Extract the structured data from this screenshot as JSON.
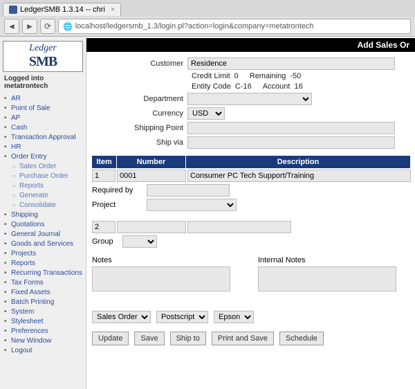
{
  "browser": {
    "tab_title": "LedgerSMB 1.3.14 -- chri",
    "url": "localhost/ledgersmb_1.3/login.pl?action=login&company=metatrontech"
  },
  "sidebar": {
    "logo_top": "Ledger",
    "logo_bottom": "SMB",
    "logged_in": "Logged into metatrontech",
    "items": [
      {
        "label": "AR",
        "sub": []
      },
      {
        "label": "Point of Sale",
        "sub": []
      },
      {
        "label": "AP",
        "sub": []
      },
      {
        "label": "Cash",
        "sub": []
      },
      {
        "label": "Transaction Approval",
        "sub": []
      },
      {
        "label": "HR",
        "sub": []
      },
      {
        "label": "Order Entry",
        "sub": [
          {
            "label": "Sales Order"
          },
          {
            "label": "Purchase Order"
          },
          {
            "label": "Reports"
          },
          {
            "label": "Generate"
          },
          {
            "label": "Consolidate"
          }
        ]
      },
      {
        "label": "Shipping",
        "sub": []
      },
      {
        "label": "Quotations",
        "sub": []
      },
      {
        "label": "General Journal",
        "sub": []
      },
      {
        "label": "Goods and Services",
        "sub": []
      },
      {
        "label": "Projects",
        "sub": []
      },
      {
        "label": "Reports",
        "sub": []
      },
      {
        "label": "Recurring Transactions",
        "sub": []
      },
      {
        "label": "Tax Forms",
        "sub": []
      },
      {
        "label": "Fixed Assets",
        "sub": []
      },
      {
        "label": "Batch Printing",
        "sub": []
      },
      {
        "label": "System",
        "sub": []
      },
      {
        "label": "Stylesheet",
        "sub": []
      },
      {
        "label": "Preferences",
        "sub": []
      },
      {
        "label": "New Window",
        "sub": []
      },
      {
        "label": "Logout",
        "sub": []
      }
    ]
  },
  "form": {
    "title": "Add Sales Or",
    "labels": {
      "customer": "Customer",
      "credit_limit": "Credit Limit",
      "remaining": "Remaining",
      "entity_code": "Entity Code",
      "account": "Account",
      "department": "Department",
      "currency": "Currency",
      "shipping_point": "Shipping Point",
      "ship_via": "Ship via",
      "required_by": "Required by",
      "project": "Project",
      "group": "Group",
      "notes": "Notes",
      "internal_notes": "Internal Notes"
    },
    "values": {
      "customer": "Residence",
      "credit_limit": "0",
      "remaining": "-50",
      "entity_code": "C-16",
      "account": "16",
      "currency": "USD",
      "shipping_point": "",
      "ship_via": "",
      "required_by": "",
      "notes": "",
      "internal_notes": ""
    },
    "grid": {
      "headers": {
        "item": "Item",
        "number": "Number",
        "description": "Description"
      },
      "rows": [
        {
          "item": "1",
          "number": "0001",
          "description": "Consumer PC Tech Support/Training"
        },
        {
          "item": "2",
          "number": "",
          "description": ""
        }
      ]
    },
    "bottom_selects": {
      "doc": "Sales Order",
      "format": "Postscript",
      "printer": "Epson"
    },
    "buttons": {
      "update": "Update",
      "save": "Save",
      "ship_to": "Ship to",
      "print_save": "Print and Save",
      "schedule": "Schedule"
    }
  }
}
